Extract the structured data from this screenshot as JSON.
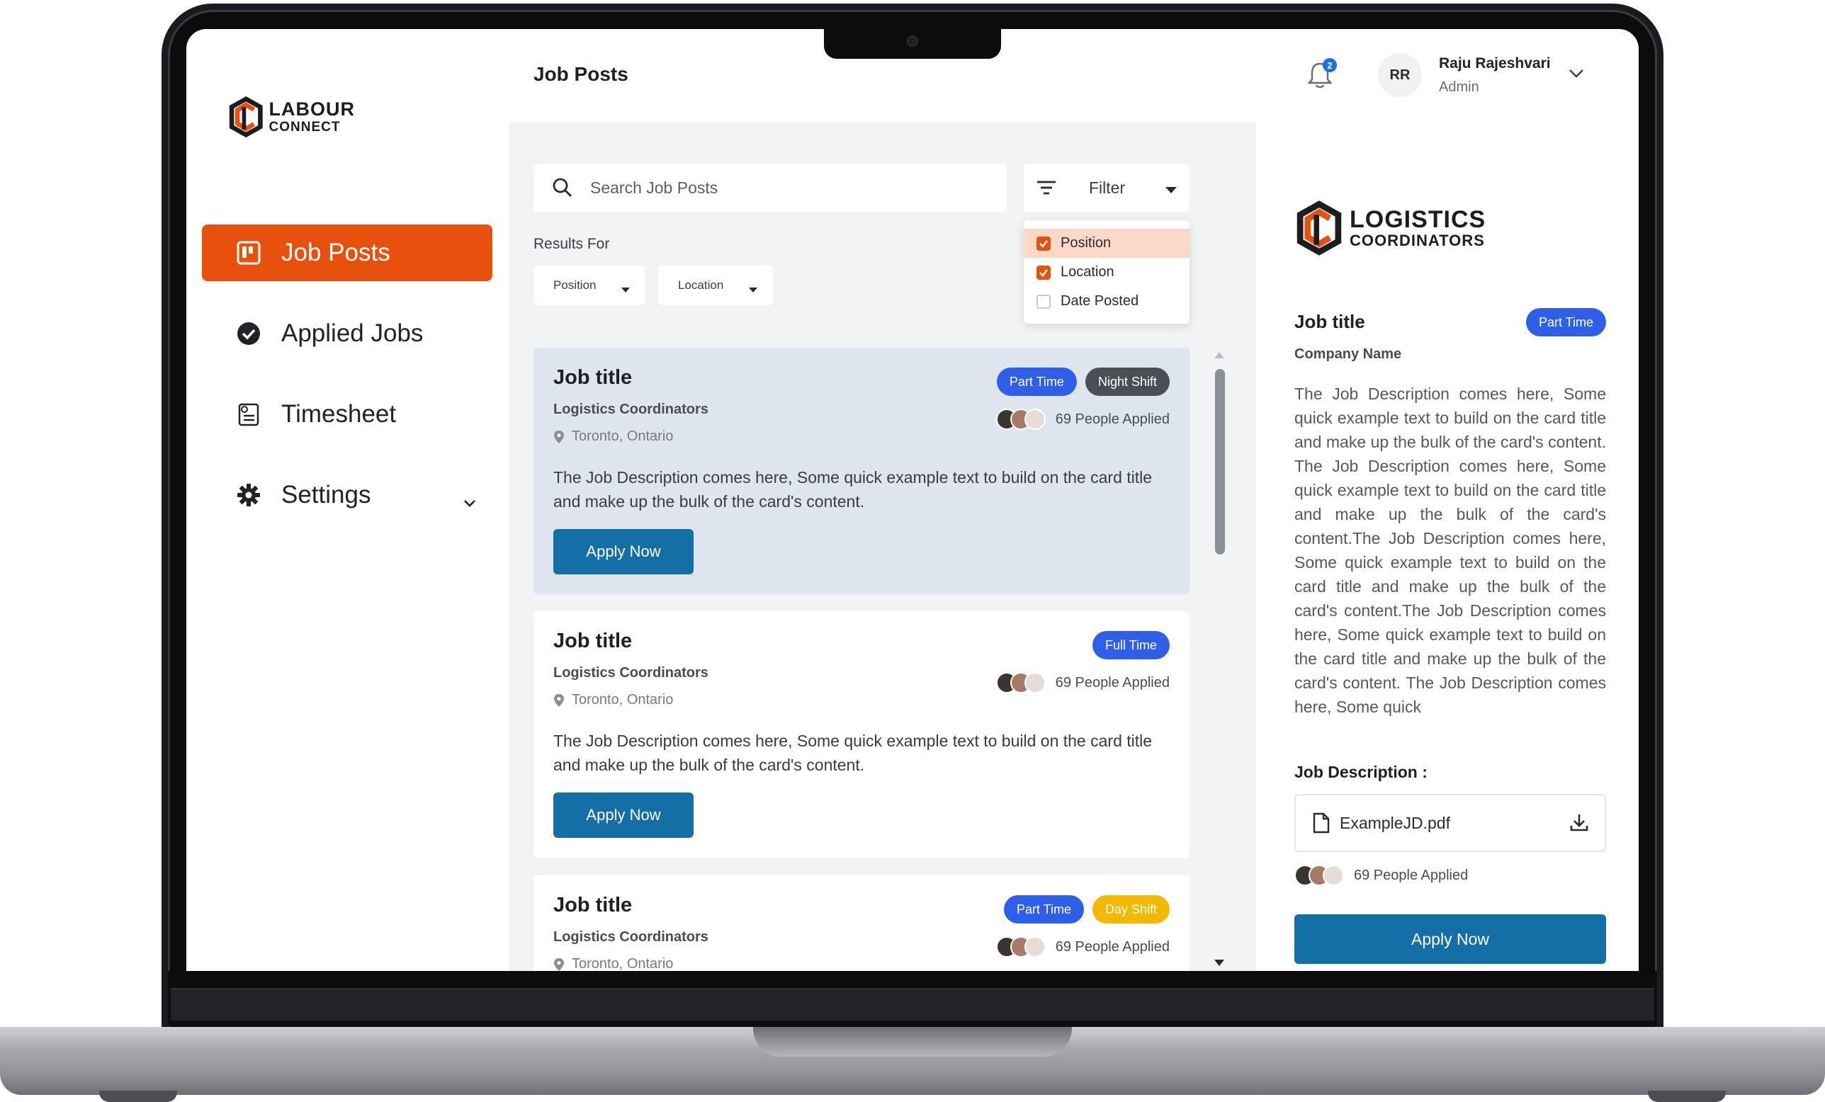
{
  "app": {
    "logo_line1": "LABOUR",
    "logo_line2": "CONNECT",
    "brand_color": "#e8500d",
    "primary_button_color": "#146fa7"
  },
  "sidebar": {
    "items": [
      {
        "label": "Job Posts",
        "icon": "board-icon",
        "active": true
      },
      {
        "label": "Applied Jobs",
        "icon": "check-circle-icon",
        "active": false
      },
      {
        "label": "Timesheet",
        "icon": "timesheet-icon",
        "active": false
      },
      {
        "label": "Settings",
        "icon": "gear-icon",
        "active": false
      }
    ]
  },
  "header": {
    "title": "Job Posts",
    "notifications_count": "2",
    "user_initials": "RR",
    "user_name": "Raju Rajeshvari",
    "user_role": "Admin"
  },
  "search": {
    "placeholder": "Search Job Posts"
  },
  "filter": {
    "label": "Filter",
    "options": [
      {
        "label": "Position",
        "checked": true
      },
      {
        "label": "Location",
        "checked": true
      },
      {
        "label": "Date Posted",
        "checked": false
      }
    ]
  },
  "results": {
    "label": "Results For",
    "chips": [
      "Position",
      "Location"
    ]
  },
  "jobs": [
    {
      "title": "Job title",
      "company": "Logistics Coordinators",
      "location": "Toronto, Ontario",
      "description": "The Job Description comes here, Some quick example text to build on the card title and make up the bulk of the card's content.",
      "apply_label": "Apply Now",
      "applied": "69 People Applied",
      "badges": [
        {
          "label": "Part Time",
          "color": "#2f5ee8"
        },
        {
          "label": "Night Shift",
          "color": "#4b4e55"
        }
      ]
    },
    {
      "title": "Job title",
      "company": "Logistics Coordinators",
      "location": "Toronto, Ontario",
      "description": "The Job Description comes here, Some quick example text to build on the card title and make up the bulk of the card's content.",
      "apply_label": "Apply Now",
      "applied": "69 People Applied",
      "badges": [
        {
          "label": "Full Time",
          "color": "#2f5ee8"
        }
      ]
    },
    {
      "title": "Job title",
      "company": "Logistics Coordinators",
      "location": "Toronto, Ontario",
      "applied": "69 People Applied",
      "badges": [
        {
          "label": "Part Time",
          "color": "#2f5ee8"
        },
        {
          "label": "Day Shift",
          "color": "#f3b800"
        }
      ]
    }
  ],
  "detail": {
    "logo_line1": "LOGISTICS",
    "logo_line2": "COORDINATORS",
    "title": "Job title",
    "badge": "Part Time",
    "company": "Company Name",
    "description": "The Job Description comes here, Some quick example text to build on the card title and make up the bulk of the card's content. The Job Description comes here, Some quick example text to build on the card title and make up the bulk of the card's content.The Job Description comes here, Some quick example text to build on the card title and make up the bulk of the card's content.The Job Description comes here, Some quick example text to build on the card title and make up the bulk of the card's content. The Job Description comes here, Some quick",
    "jd_label": "Job Description :",
    "file_name": "ExampleJD.pdf",
    "applied": "69 People Applied",
    "apply_label": "Apply Now"
  }
}
